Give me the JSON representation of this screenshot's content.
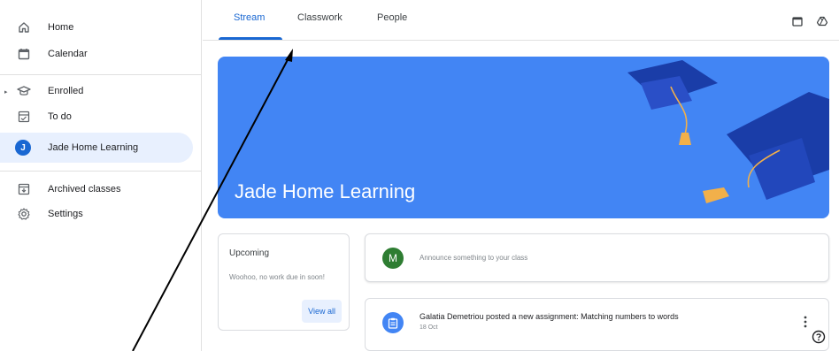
{
  "sidebar": {
    "items": [
      {
        "label": "Home",
        "icon": "home-icon"
      },
      {
        "label": "Calendar",
        "icon": "calendar-icon"
      },
      {
        "label": "Enrolled",
        "icon": "enrolled-icon"
      },
      {
        "label": "To do",
        "icon": "todo-icon"
      },
      {
        "label": "Jade Home Learning",
        "icon": "class-avatar",
        "avatar_letter": "J",
        "active": true
      },
      {
        "label": "Archived classes",
        "icon": "archive-icon"
      },
      {
        "label": "Settings",
        "icon": "settings-icon"
      }
    ]
  },
  "tabs": [
    {
      "label": "Stream",
      "active": true
    },
    {
      "label": "Classwork"
    },
    {
      "label": "People"
    }
  ],
  "top_icons": [
    "calendar-icon",
    "drive-icon"
  ],
  "banner": {
    "title": "Jade Home Learning",
    "color": "#4285f4"
  },
  "upcoming": {
    "title": "Upcoming",
    "message": "Woohoo, no work due in soon!",
    "button": "View all"
  },
  "announce": {
    "avatar_letter": "M",
    "placeholder": "Announce something to your class"
  },
  "post": {
    "title": "Galatia Demetriou posted a new assignment: Matching numbers to words",
    "date": "18 Oct",
    "icon": "assignment-icon"
  },
  "colors": {
    "accent": "#1967d2",
    "banner": "#4285f4",
    "announce_avatar": "#2e7d32",
    "active_bg": "#e8f0fe"
  }
}
